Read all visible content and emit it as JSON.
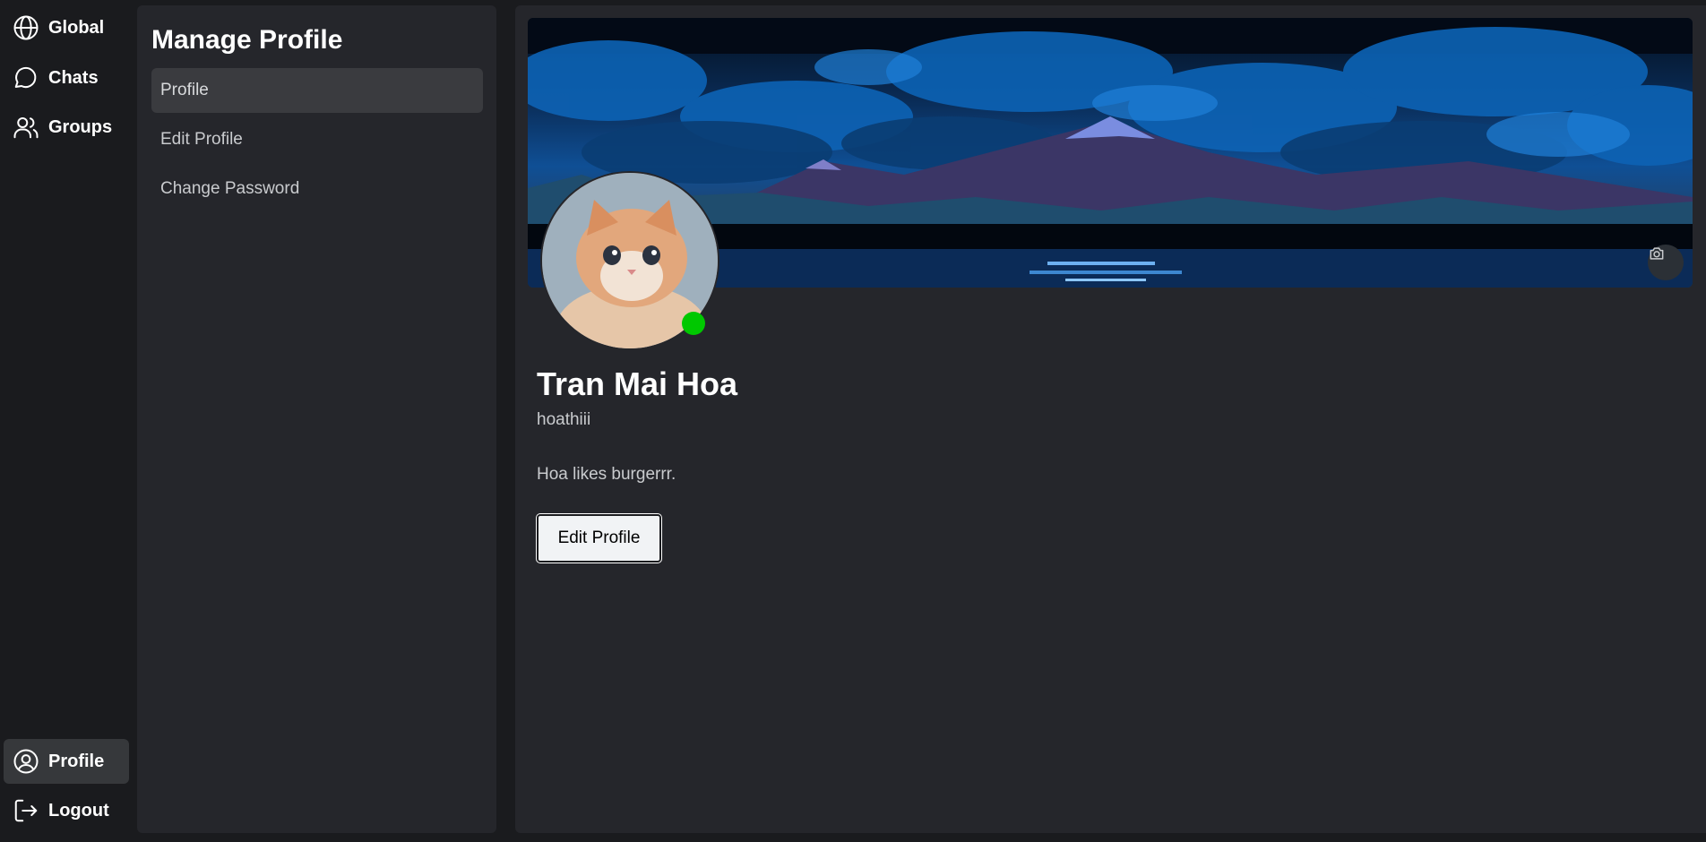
{
  "nav": {
    "top_items": [
      {
        "label": "Global",
        "icon": "globe-icon"
      },
      {
        "label": "Chats",
        "icon": "chat-bubble-icon"
      },
      {
        "label": "Groups",
        "icon": "users-icon"
      }
    ],
    "bottom_items": [
      {
        "label": "Profile",
        "icon": "user-circle-icon",
        "active": true
      },
      {
        "label": "Logout",
        "icon": "logout-icon"
      }
    ]
  },
  "panel": {
    "title": "Manage Profile",
    "items": [
      {
        "label": "Profile",
        "active": true
      },
      {
        "label": "Edit Profile"
      },
      {
        "label": "Change Password"
      }
    ]
  },
  "profile": {
    "display_name": "Tran Mai Hoa",
    "username": "hoathiii",
    "bio": "Hoa likes burgerrr.",
    "edit_button": "Edit Profile",
    "status": "online",
    "status_color": "#00c800"
  },
  "colors": {
    "background": "#1a1b1e",
    "panel": "#25262b",
    "active_item": "#3a3b3f"
  }
}
